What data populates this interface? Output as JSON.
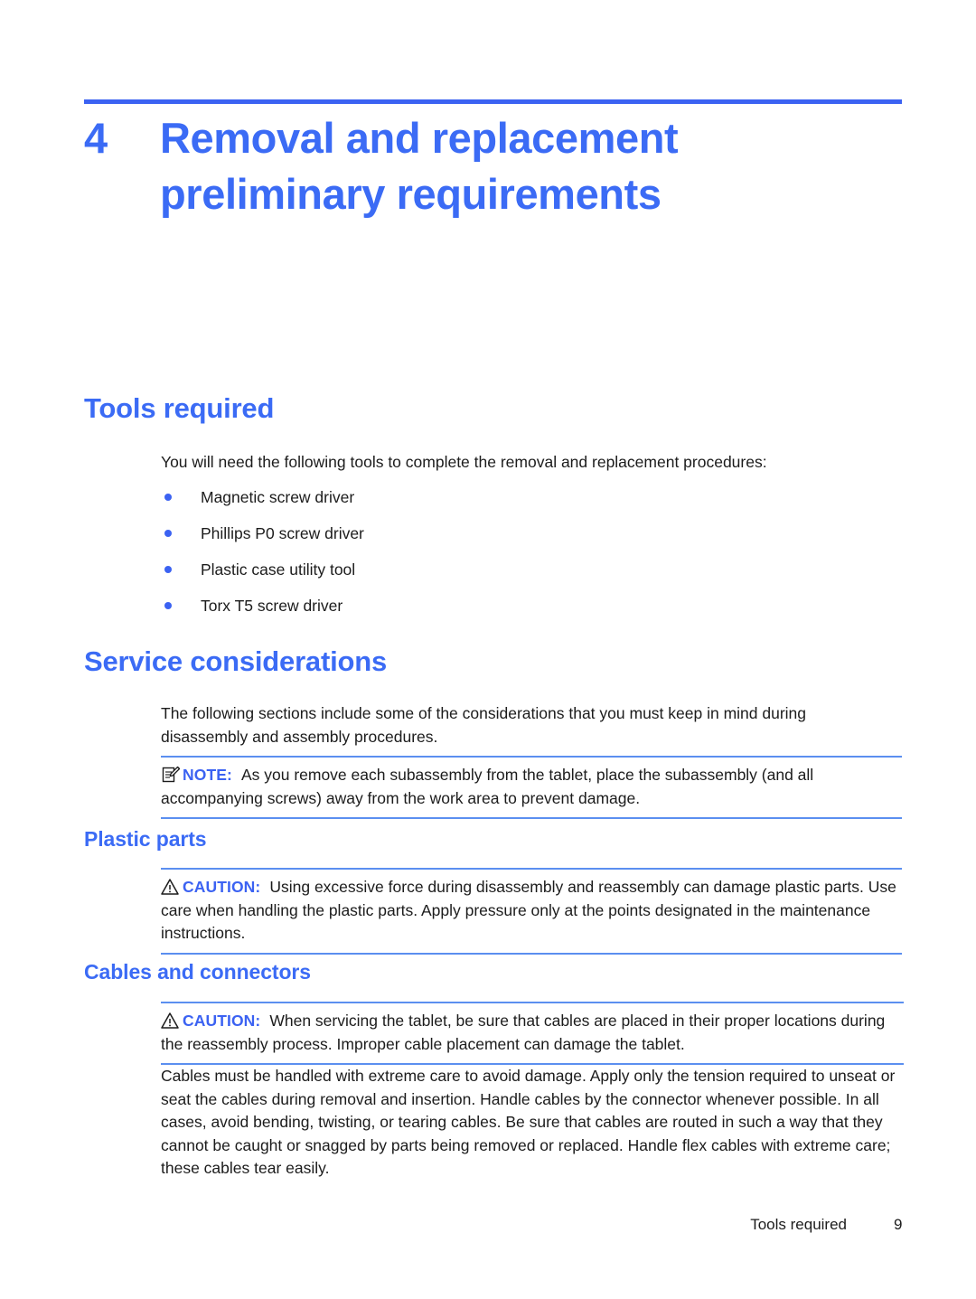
{
  "document": {
    "chapter": {
      "number": "4",
      "title": "Removal and replacement preliminary requirements"
    },
    "sections": [
      {
        "id": "tools-required",
        "heading": "Tools required",
        "intro": "You will need the following tools to complete the removal and replacement procedures:",
        "bullets": [
          "Magnetic screw driver",
          "Phillips P0 screw driver",
          "Plastic case utility tool",
          "Torx T5 screw driver"
        ]
      },
      {
        "id": "service-considerations",
        "heading": "Service considerations",
        "intro": "The following sections include some of the considerations that you must keep in mind during disassembly and assembly procedures.",
        "note": {
          "icon": "note-pad-pencil-icon",
          "label": "NOTE:",
          "text": "As you remove each subassembly from the tablet, place the subassembly (and all accompanying screws) away from the work area to prevent damage."
        }
      },
      {
        "id": "plastic-parts",
        "heading": "Plastic parts",
        "caution": {
          "icon": "warning-triangle-icon",
          "label": "CAUTION:",
          "text": "Using excessive force during disassembly and reassembly can damage plastic parts. Use care when handling the plastic parts. Apply pressure only at the points designated in the maintenance instructions."
        }
      },
      {
        "id": "cables-and-connectors",
        "heading": "Cables and connectors",
        "caution": {
          "icon": "warning-triangle-icon",
          "label": "CAUTION:",
          "text": "When servicing the tablet, be sure that cables are placed in their proper locations during the reassembly process. Improper cable placement can damage the tablet."
        },
        "body": "Cables must be handled with extreme care to avoid damage. Apply only the tension required to unseat or seat the cables during removal and insertion. Handle cables by the connector whenever possible. In all cases, avoid bending, twisting, or tearing cables. Be sure that cables are routed in such a way that they cannot be caught or snagged by parts being removed or replaced. Handle flex cables with extreme care; these cables tear easily."
      }
    ],
    "footer": {
      "section_label": "Tools required",
      "page_number": "9"
    },
    "colors": {
      "heading_blue": "#3b6bf5",
      "rule_blue": "#3b62f2",
      "admonition_rule": "#5b8ff0",
      "body_text": "#1c1c1c"
    }
  }
}
